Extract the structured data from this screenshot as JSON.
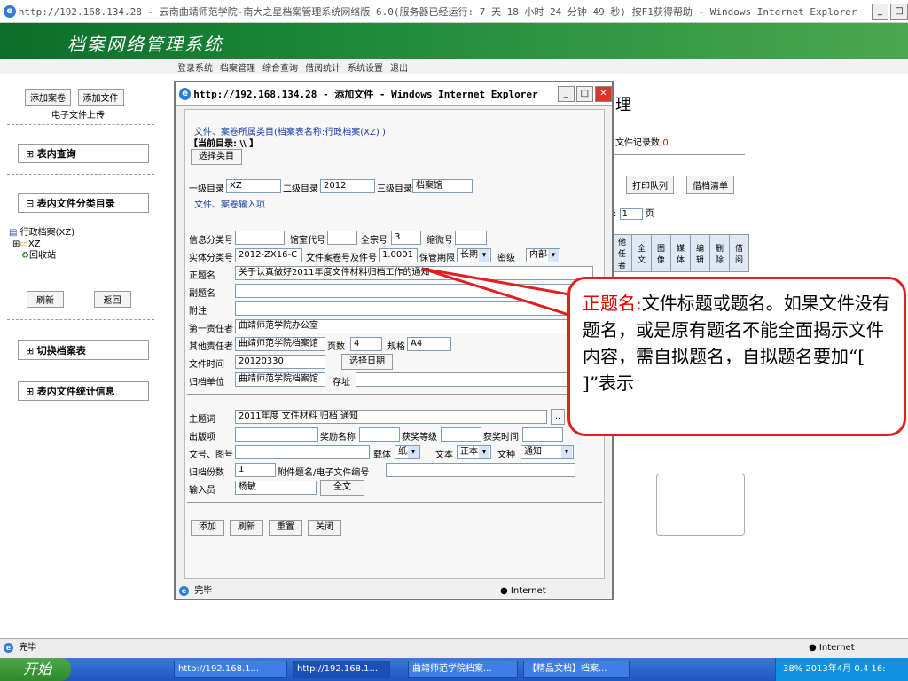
{
  "outer_window": {
    "title": "http://192.168.134.28 - 云南曲靖师范学院-南大之星档案管理系统网络版 6.0(服务器已经运行: 7 天 18 小时 24 分钟 49 秒) 按F1获得帮助 - Windows Internet Explorer",
    "status_text": "完毕",
    "status_zone": "Internet"
  },
  "app": {
    "brand": "档案网络管理系统",
    "nav": [
      "登录系统",
      "档案管理",
      "综合查询",
      "借阅统计",
      "系统设置",
      "退出"
    ]
  },
  "left_panel": {
    "add_volume": "添加案卷",
    "add_file": "添加文件",
    "e_upload": "电子文件上传",
    "section_query": "表内查询",
    "section_category": "表内文件分类目录",
    "tree": [
      "行政档案(XZ)",
      "XZ",
      "回收站"
    ],
    "refresh": "刷新",
    "back": "返回",
    "switch_table": "切换档案表",
    "stats": "表内文件统计信息"
  },
  "background_main": {
    "title_fragment": "理",
    "record_count_label": "文件记录数:",
    "record_count": "0",
    "print_queue": "打印队列",
    "borrow_list": "借档清单",
    "page_prefix": ":",
    "page_value": "1",
    "page_suffix": "页",
    "table_headers": [
      "他任者",
      "全文",
      "图像",
      "媒体",
      "编辑",
      "删除",
      "借阅"
    ]
  },
  "popup": {
    "title": "http://192.168.134.28 - 添加文件 - Windows Internet Explorer",
    "category_line": "文件、案卷所属类目(档案表名称:行政档案(XZ) )",
    "current_dir": "【当前目录: \\\\ 】",
    "select_category": "选择类目",
    "level1_label": "一级目录",
    "level1_value": "XZ",
    "level2_label": "二级目录",
    "level2_value": "2012",
    "level3_label": "三级目录",
    "level3_value": "档案馆",
    "input_section": "文件、案卷输入项",
    "info_category_label": "信息分类号",
    "info_category_value": "",
    "archive_code_label": "馆室代号",
    "archive_code_value": "",
    "fonds_label": "全宗号",
    "fonds_value": "3",
    "microfilm_label": "缩微号",
    "microfilm_value": "",
    "entity_label": "实体分类号",
    "entity_value": "2012-ZX16-C",
    "volume_no_label": "文件案卷号及件号",
    "volume_no_value": "1.0001",
    "retention_label": "保管期限",
    "retention_value": "长期",
    "secret_label": "密级",
    "secret_value": "内部",
    "main_title_label": "正题名",
    "main_title_value": "关于认真做好2011年度文件材料归档工作的通知",
    "sub_title_label": "副题名",
    "sub_title_value": "",
    "note_label": "附注",
    "note_value": "",
    "resp1_label": "第一责任者",
    "resp1_value": "曲靖师范学院办公室",
    "resp_other_label": "其他责任者",
    "resp_other_value": "曲靖师范学院档案馆",
    "pages_label": "页数",
    "pages_value": "4",
    "spec_label": "规格",
    "spec_value": "A4",
    "date_label": "文件时间",
    "date_value": "20120330",
    "pick_date": "选择日期",
    "archive_unit_label": "归档单位",
    "archive_unit_value": "曲靖师范学院档案馆",
    "location_label": "存址",
    "location_value": "",
    "subject_label": "主题词",
    "subject_value": "2011年度  文件材料  归档  通知",
    "edition_label": "出版项",
    "edition_value": "",
    "award_name_label": "奖励名称",
    "award_name_value": "",
    "award_level_label": "获奖等级",
    "award_level_value": "",
    "award_time_label": "获奖时间",
    "award_time_value": "",
    "doc_no_label": "文号、图号",
    "doc_no_value": "",
    "carrier_label": "载体",
    "carrier_value": "纸",
    "text_label": "文本",
    "text_value": "正本",
    "doc_type_label": "文种",
    "doc_type_value": "通知",
    "copies_label": "归档份数",
    "copies_value": "1",
    "attach_label": "附件题名/电子文件编号",
    "attach_value": "",
    "operator_label": "输入员",
    "operator_value": "杨敏",
    "fulltext": "全文",
    "btn_add": "添加",
    "btn_refresh": "刷新",
    "btn_reset": "重置",
    "btn_close": "关闭",
    "status_text": "完毕",
    "status_zone": "Internet"
  },
  "callout": {
    "term": "正题名:",
    "text": "文件标题或题名。如果文件没有题名，或是原有题名不能全面揭示文件内容，需自拟题名，自拟题名要加“[ ]”表示"
  },
  "taskbar": {
    "start": "开始",
    "tasks": [
      "http://192.168.1...",
      "http://192.168.1...",
      "曲靖师范学院档案...",
      "【精品文档】档案..."
    ],
    "tray_date": "2013年4月",
    "tray_pct": "38%",
    "tray_num": "0.4",
    "tray_time": "16:"
  },
  "colors": {
    "accent_red": "#e00000",
    "header_green": "#1f8a3a",
    "link_blue": "#1b3fa6"
  }
}
